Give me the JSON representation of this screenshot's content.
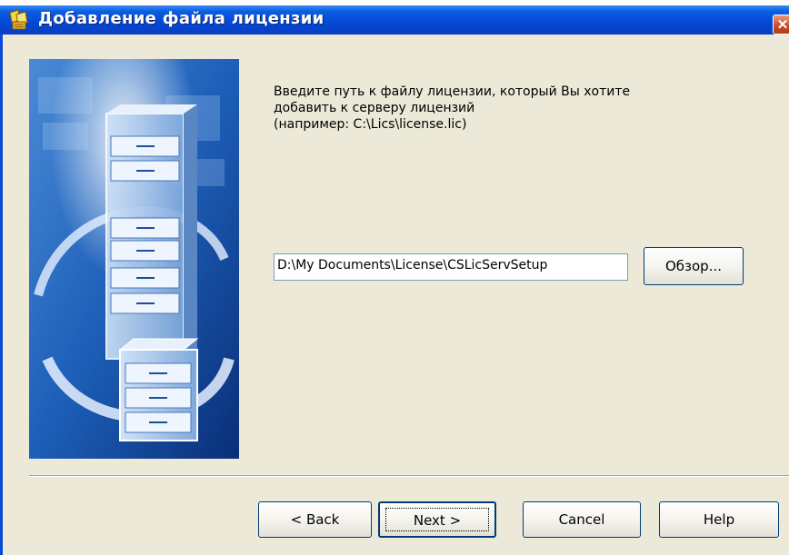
{
  "window": {
    "title": "Добавление файла лицензии",
    "close_glyph": "✕"
  },
  "content": {
    "instruction_line1": "Введите путь к файлу лицензии, который Вы хотите",
    "instruction_line2": "добавить к серверу лицензий",
    "instruction_line3": "(например: C:\\Lics\\license.lic)",
    "path_value": "D:\\My Documents\\License\\CSLicServSetup",
    "browse_label": "Обзор..."
  },
  "buttons": {
    "back_label": "< Back",
    "next_label": "Next >",
    "cancel_label": "Cancel",
    "help_label": "Help"
  },
  "colors": {
    "title_blue": "#0447d6",
    "dialog_bg": "#ece9d8",
    "close_red": "#c84a25"
  }
}
